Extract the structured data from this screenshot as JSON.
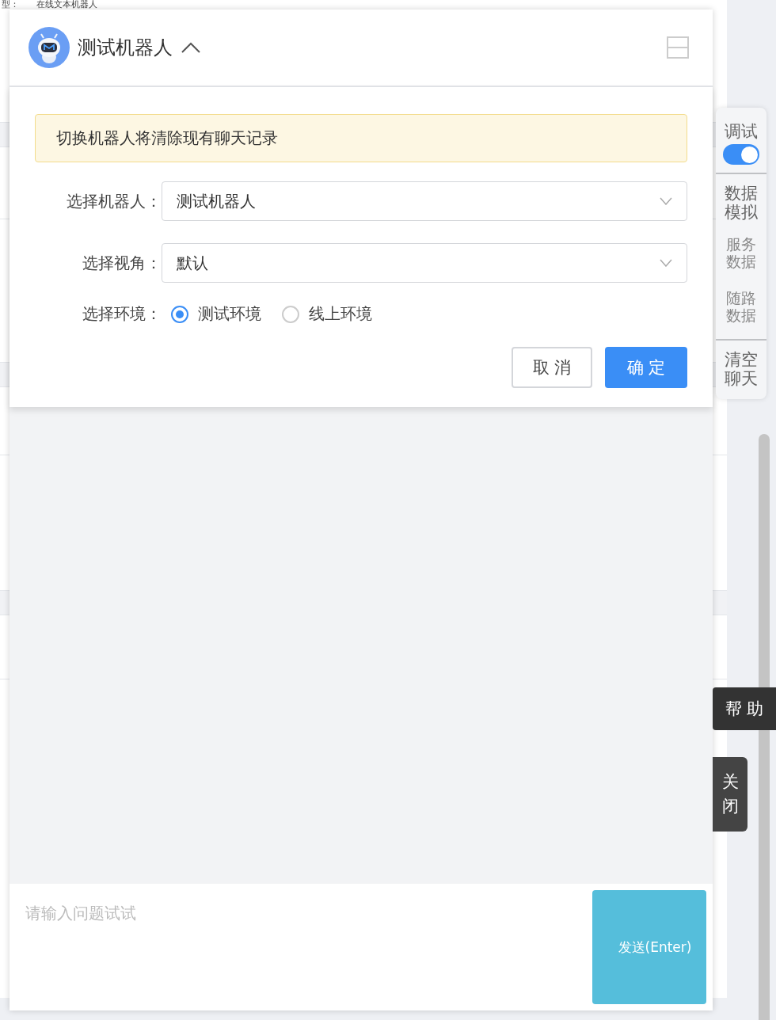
{
  "background": {
    "label": "型：",
    "value": "在线文本机器人"
  },
  "chat": {
    "bot_name": "测试机器人",
    "expanded": true,
    "switcher": {
      "warning": "切换机器人将清除现有聊天记录",
      "fields": [
        {
          "label": "选择机器人：",
          "value": "测试机器人"
        },
        {
          "label": "选择视角：",
          "value": "默认"
        }
      ],
      "environment": {
        "label": "选择环境：",
        "options": [
          {
            "label": "测试环境",
            "selected": true
          },
          {
            "label": "线上环境",
            "selected": false
          }
        ]
      },
      "buttons": [
        {
          "label": "取 消",
          "kind": "secondary"
        },
        {
          "label": "确 定",
          "kind": "primary"
        }
      ]
    },
    "input": {
      "placeholder": "请输入问题试试"
    },
    "send_button": "发送(Enter)"
  },
  "tools": [
    {
      "kind": "toggle",
      "label": "调试",
      "on": true
    },
    {
      "kind": "group",
      "label": "数据模拟",
      "items": [
        "服务数据",
        "随路数据"
      ]
    },
    {
      "kind": "action",
      "label": "清空聊天"
    }
  ],
  "help_tab": "帮 助",
  "close_tab": "关闭"
}
